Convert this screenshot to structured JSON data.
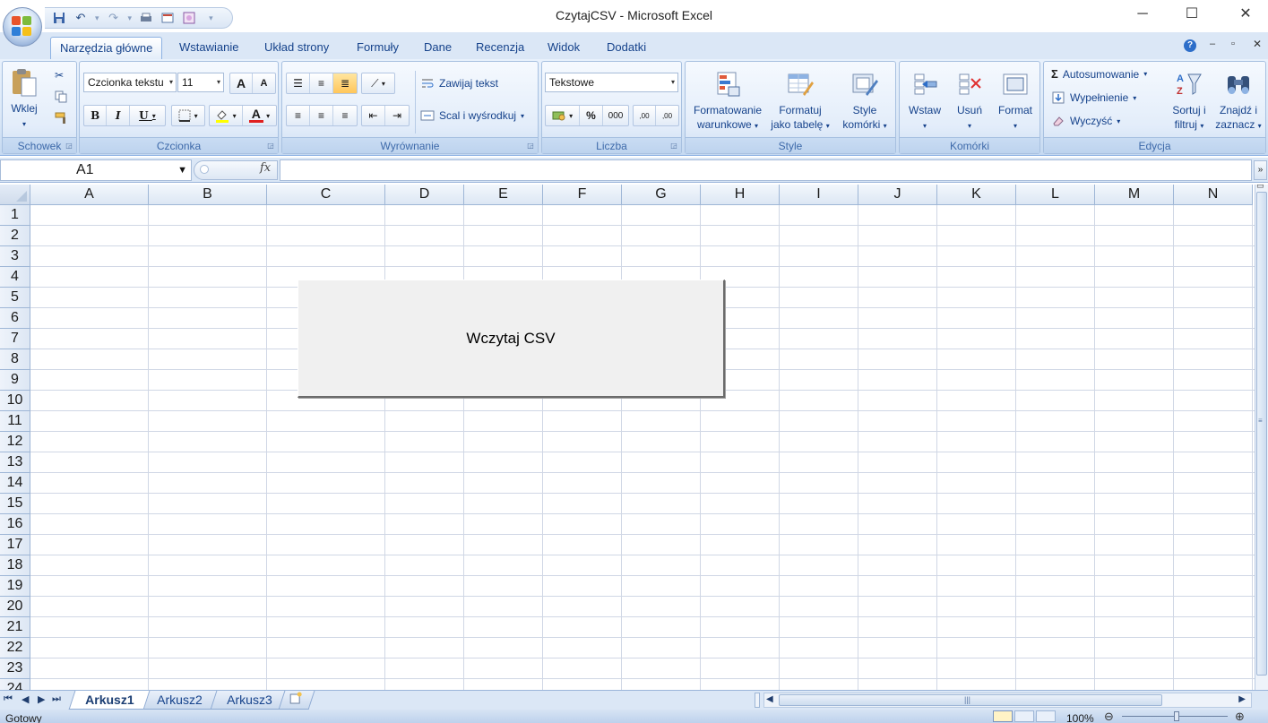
{
  "window": {
    "title": "CzytajCSV - Microsoft Excel"
  },
  "ribbon": {
    "tabs": [
      "Narzędzia główne",
      "Wstawianie",
      "Układ strony",
      "Formuły",
      "Dane",
      "Recenzja",
      "Widok",
      "Dodatki"
    ],
    "active_tab": "Narzędzia główne",
    "clipboard": {
      "label": "Schowek",
      "paste": "Wklej"
    },
    "font": {
      "label": "Czcionka",
      "font_name": "Czcionka tekstu",
      "font_size": "11",
      "bold": "B",
      "italic": "I",
      "underline": "U",
      "grow": "A",
      "shrink": "A",
      "font_color": "A"
    },
    "alignment": {
      "label": "Wyrównanie",
      "wrap_text": "Zawijaj tekst",
      "merge_center": "Scal i wyśrodkuj"
    },
    "number": {
      "label": "Liczba",
      "format": "Tekstowe",
      "percent": "%",
      "thousands": "000",
      "inc_decimal": ",00",
      "dec_decimal": ",00"
    },
    "styles": {
      "label": "Style",
      "conditional": [
        "Formatowanie",
        "warunkowe"
      ],
      "as_table": [
        "Formatuj",
        "jako tabelę"
      ],
      "cell_styles": [
        "Style",
        "komórki"
      ]
    },
    "cells": {
      "label": "Komórki",
      "insert": "Wstaw",
      "delete": "Usuń",
      "format": "Format"
    },
    "editing": {
      "label": "Edycja",
      "autosum": "Autosumowanie",
      "fill": "Wypełnienie",
      "clear": "Wyczyść",
      "sort": [
        "Sortuj i",
        "filtruj"
      ],
      "find": [
        "Znajdź i",
        "zaznacz"
      ]
    }
  },
  "formula_bar": {
    "name_box": "A1",
    "fx": "fx",
    "expand": "»"
  },
  "grid": {
    "columns": [
      "A",
      "B",
      "C",
      "D",
      "E",
      "F",
      "G",
      "H",
      "I",
      "J",
      "K",
      "L",
      "M",
      "N"
    ],
    "rows": [
      "1",
      "2",
      "3",
      "4",
      "5",
      "6",
      "7",
      "8",
      "9",
      "10",
      "11",
      "12",
      "13",
      "14",
      "15",
      "16",
      "17",
      "18",
      "19",
      "20",
      "21",
      "22",
      "23",
      "24"
    ]
  },
  "form_button": {
    "label": "Wczytaj CSV"
  },
  "sheets": {
    "tabs": [
      "Arkusz1",
      "Arkusz2",
      "Arkusz3"
    ],
    "active": "Arkusz1"
  },
  "status": {
    "text": "Gotowy",
    "zoom": "100%"
  },
  "colors": {
    "accent": "#15428b",
    "ribbon_bg": "#dbe8f7",
    "highlight": "#ffc65a",
    "gridline": "#d0d7e5"
  }
}
